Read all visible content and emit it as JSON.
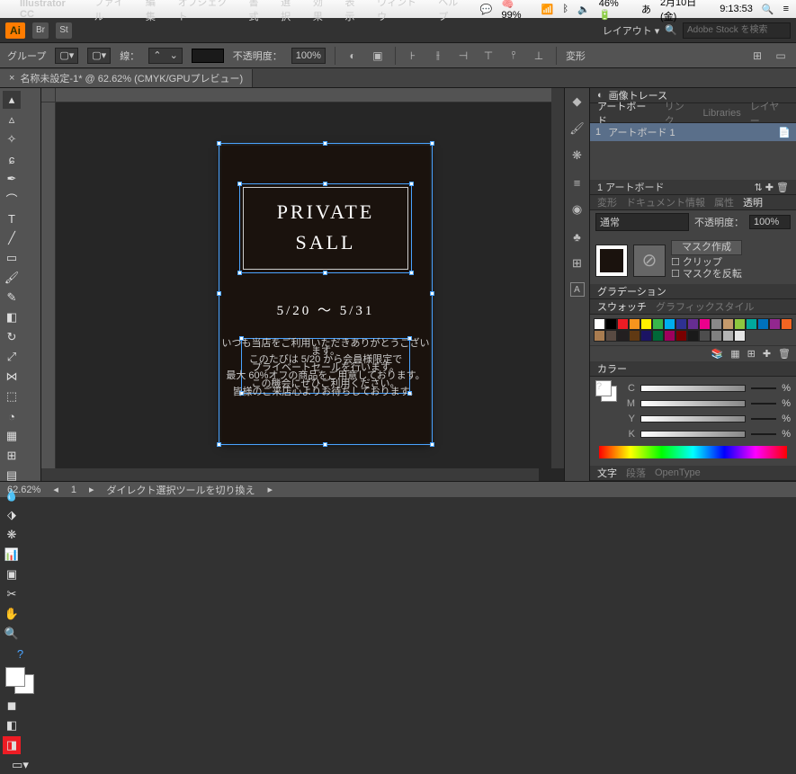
{
  "menubar": {
    "app": "Illustrator CC",
    "items": [
      "ファイル",
      "編集",
      "オブジェクト",
      "書式",
      "選択",
      "効果",
      "表示",
      "ウィンドウ",
      "ヘルプ"
    ],
    "right": {
      "mem": "99%",
      "battery": "46%",
      "date": "2月10日(金)",
      "time": "9:13:53"
    }
  },
  "appbar": {
    "ai": "Ai",
    "br": "Br",
    "st": "St",
    "layout": "レイアウト ▾",
    "search_placeholder": "Adobe Stock を検索"
  },
  "optbar": {
    "label_group": "グループ",
    "stroke": "線：",
    "opacity_label": "不透明度：",
    "opacity_val": "100%",
    "transform": "変形"
  },
  "tab": {
    "name": "名称未設定-1* @ 62.62% (CMYK/GPUプレビュー)"
  },
  "artwork": {
    "title1": "PRIVATE",
    "title2": "SALL",
    "dates": "5/20 ～ 5/31",
    "body": [
      "いつも当店をご利用いただきありがとうございます。",
      "このたびは 5/20 から会員様限定で",
      "プライベートセールを行います。",
      "最大 60%オフの商品をご用意しております。",
      "この機会にぜひご利用ください。",
      "皆様のご来店心よりお待ちしております。"
    ]
  },
  "panels": {
    "toprow": {
      "trace": "画像トレース"
    },
    "tabs1": [
      "アートボード",
      "リンク",
      "Libraries",
      "レイヤー"
    ],
    "artboard_row": {
      "num": "1",
      "name": "アートボード 1"
    },
    "artboard_count": "1 アートボード",
    "tabs2": [
      "変形",
      "ドキュメント情報",
      "属性",
      "透明"
    ],
    "blend": "通常",
    "opacity_label": "不透明度：",
    "opacity_val": "100%",
    "mask_make": "マスク作成",
    "clip": "クリップ",
    "invert": "マスクを反転",
    "grad_title": "グラデーション",
    "tabs3": [
      "スウォッチ",
      "グラフィックスタイル"
    ],
    "color_title": "カラー",
    "cmyk": {
      "C": "",
      "M": "",
      "Y": "",
      "K": ""
    },
    "tabs4": [
      "文字",
      "段落",
      "OpenType"
    ]
  },
  "status": {
    "zoom": "62.62%",
    "artnum": "1",
    "hint": "ダイレクト選択ツールを切り換え"
  },
  "swatches": [
    "#fff",
    "#000",
    "#ed1c24",
    "#f7941d",
    "#fff200",
    "#39b54a",
    "#00aeef",
    "#2e3192",
    "#662d91",
    "#ec008c",
    "#898989",
    "#c49a6c",
    "#8dc63f",
    "#00a99d",
    "#0072bc",
    "#92278f",
    "#f26522",
    "#a97c50",
    "#594a42",
    "#231f20",
    "#603913",
    "#1b1464",
    "#006838",
    "#9e005d",
    "#790000",
    "#1a1a1a",
    "#4d4d4d",
    "#808080",
    "#b3b3b3",
    "#e6e6e6"
  ]
}
